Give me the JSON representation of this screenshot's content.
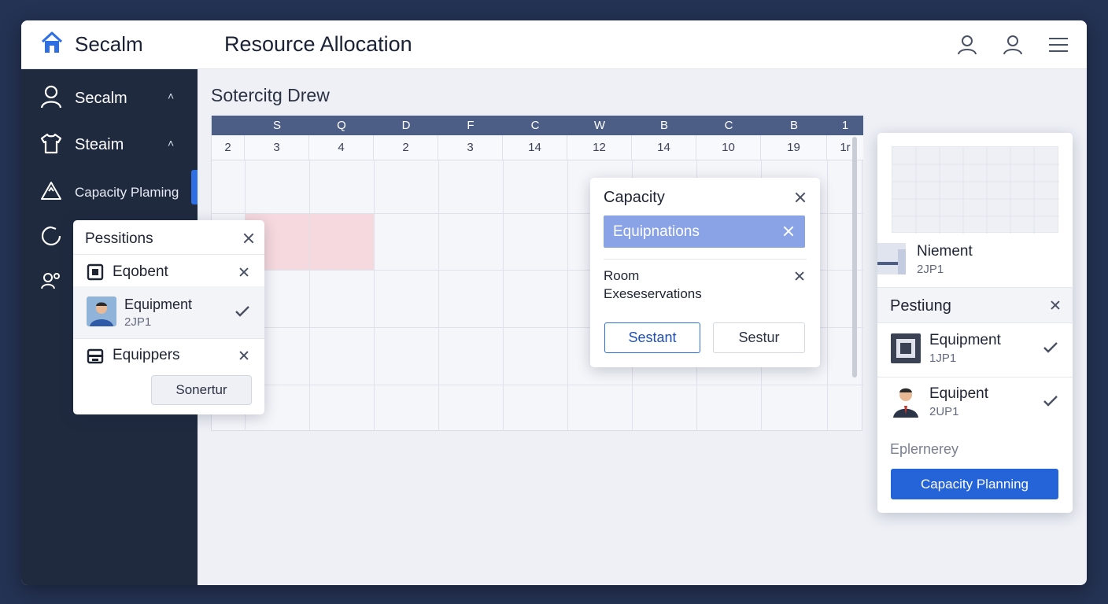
{
  "header": {
    "brand": "Secalm",
    "title": "Resource Allocation",
    "icons": [
      "home-icon",
      "user-icon",
      "user-icon",
      "menu-icon"
    ]
  },
  "sidebar": {
    "items": [
      {
        "label": "Secalm",
        "icon": "user-icon",
        "chevron": "˄"
      },
      {
        "label": "Steaim",
        "icon": "shirt-icon",
        "chevron": "˄"
      },
      {
        "label": "Capacity Plaming",
        "icon": "warning-icon"
      },
      {
        "label": "",
        "icon": "refresh-icon"
      },
      {
        "label": "",
        "icon": "people-icon"
      }
    ]
  },
  "main": {
    "section_title": "Sotercitg Drew",
    "grid": {
      "headers": [
        "",
        "S",
        "Q",
        "D",
        "F",
        "C",
        "W",
        "B",
        "C",
        "B",
        "1"
      ],
      "numbers": [
        "2",
        "3",
        "4",
        "2",
        "3",
        "14",
        "12",
        "14",
        "10",
        "19",
        "1r"
      ]
    }
  },
  "positions_popup": {
    "title": "Pessitions",
    "rows": [
      {
        "label": "Eqobent"
      },
      {
        "label": "Equipment",
        "sub": "2JP1"
      },
      {
        "label": "Equippers"
      }
    ],
    "button": "Sonertur"
  },
  "capacity_popup": {
    "title": "Capacity",
    "chip": "Equipnations",
    "room_line1": "Room",
    "room_line2": "Exeseservations",
    "btn_primary": "Sestant",
    "btn_secondary": "Sestur"
  },
  "right_panel": {
    "profile_name": "Niement",
    "profile_sub": "2JP1",
    "section_title": "Pestiung",
    "items": [
      {
        "label": "Equipment",
        "sub": "1JP1"
      },
      {
        "label": "Equipent",
        "sub": "2UP1"
      }
    ],
    "footer_label": "Eplernerey",
    "cta": "Capacity Planning"
  },
  "colors": {
    "accent": "#2563d8",
    "sidebar_bg": "#1f2a3f",
    "grid_header": "#4d5e86",
    "highlight": "#f6d9de",
    "chip": "#8aa2e6"
  }
}
